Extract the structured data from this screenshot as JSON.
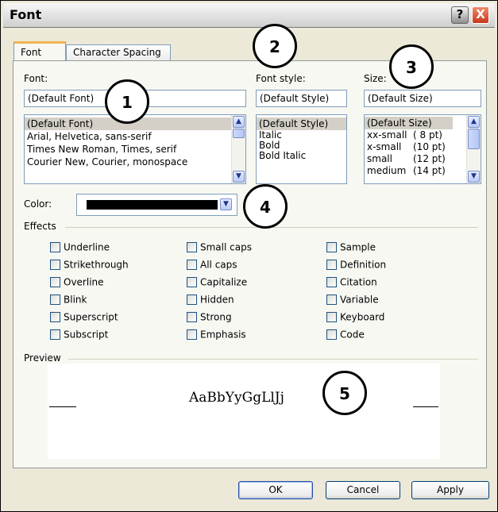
{
  "window": {
    "title": "Font",
    "help_label": "?",
    "close_label": "X"
  },
  "tabs": [
    {
      "label": "Font",
      "active": true
    },
    {
      "label": "Character Spacing",
      "active": false
    }
  ],
  "font": {
    "label": "Font:",
    "value": "(Default Font)",
    "options": [
      "(Default Font)",
      "Arial, Helvetica, sans-serif",
      "Times New Roman, Times, serif",
      "Courier New, Courier, monospace"
    ],
    "selected_index": 0
  },
  "font_style": {
    "label": "Font style:",
    "value": "(Default Style)",
    "options": [
      "(Default Style)",
      "Italic",
      "Bold",
      "Bold Italic"
    ],
    "selected_index": 0
  },
  "size": {
    "label": "Size:",
    "value": "(Default Size)",
    "options": [
      {
        "name": "(Default Size)",
        "pt": ""
      },
      {
        "name": "xx-small",
        "pt": "( 8 pt)"
      },
      {
        "name": "x-small",
        "pt": "(10 pt)"
      },
      {
        "name": "small",
        "pt": "(12 pt)"
      },
      {
        "name": "medium",
        "pt": "(14 pt)"
      }
    ],
    "selected_index": 0
  },
  "color": {
    "label": "Color:",
    "swatch": "#000000"
  },
  "effects": {
    "label": "Effects",
    "columns": [
      [
        "Underline",
        "Strikethrough",
        "Overline",
        "Blink",
        "Superscript",
        "Subscript"
      ],
      [
        "Small caps",
        "All caps",
        "Capitalize",
        "Hidden",
        "Strong",
        "Emphasis"
      ],
      [
        "Sample",
        "Definition",
        "Citation",
        "Variable",
        "Keyboard",
        "Code"
      ]
    ]
  },
  "preview": {
    "label": "Preview",
    "sample_text": "AaBbYyGgLlJj"
  },
  "buttons": {
    "ok": "OK",
    "cancel": "Cancel",
    "apply": "Apply"
  },
  "callouts": [
    "1",
    "2",
    "3",
    "4",
    "5"
  ],
  "colors": {
    "tab_accent": "#f4b450",
    "list_border": "#7f9db9",
    "close_red": "#c7381b"
  }
}
